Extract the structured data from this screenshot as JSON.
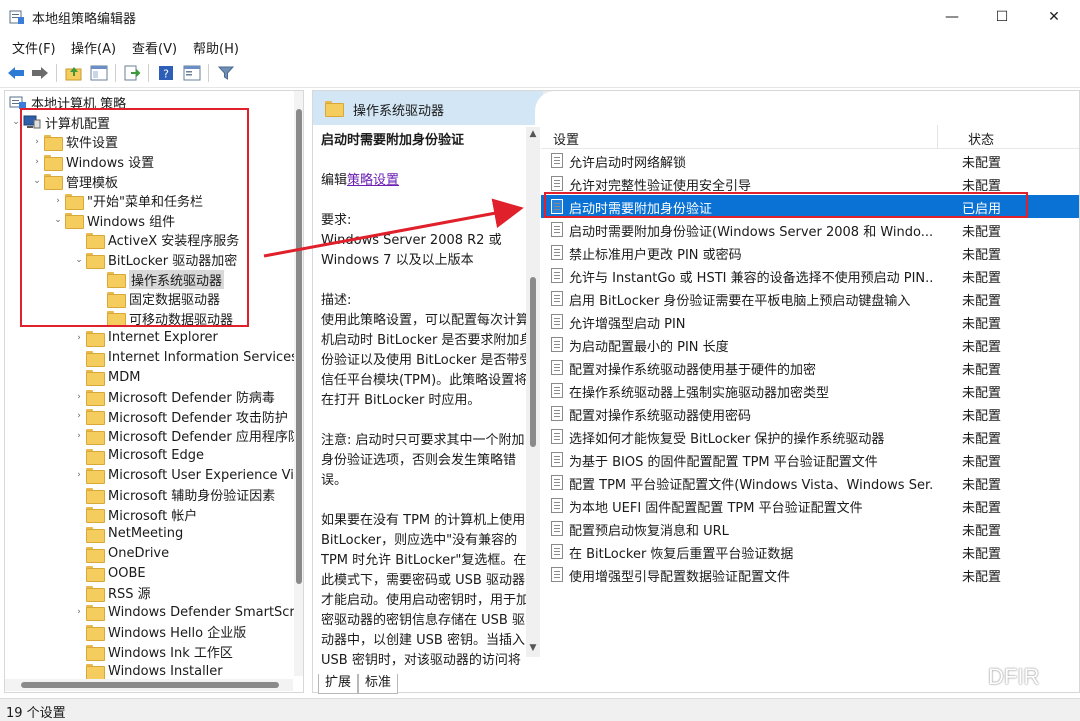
{
  "window": {
    "title": "本地组策略编辑器",
    "minimize": "—",
    "maximize": "☐",
    "close": "✕"
  },
  "menu": [
    "文件(F)",
    "操作(A)",
    "查看(V)",
    "帮助(H)"
  ],
  "toolbar": {
    "icons": [
      "back-arrow-icon",
      "forward-arrow-icon",
      "up-folder-icon",
      "show-hide-tree-icon",
      "export-list-icon",
      "help-icon",
      "properties-icon",
      "filter-icon"
    ]
  },
  "tree": {
    "items": [
      {
        "label": "本地计算机 策略",
        "icon": "computer-policy-icon",
        "arrow": ""
      },
      {
        "label": "计算机配置",
        "icon": "computer-icon",
        "arrow": "⌄"
      },
      {
        "label": "软件设置",
        "icon": "folder-icon",
        "arrow": "›"
      },
      {
        "label": "Windows 设置",
        "icon": "folder-icon",
        "arrow": "›"
      },
      {
        "label": "管理模板",
        "icon": "folder-icon",
        "arrow": "⌄"
      },
      {
        "label": "\"开始\"菜单和任务栏",
        "icon": "folder-icon",
        "arrow": "›"
      },
      {
        "label": "Windows 组件",
        "icon": "folder-icon",
        "arrow": "⌄"
      },
      {
        "label": "ActiveX 安装程序服务",
        "icon": "folder-icon",
        "arrow": ""
      },
      {
        "label": "BitLocker 驱动器加密",
        "icon": "folder-icon",
        "arrow": "⌄"
      },
      {
        "label": "操作系统驱动器",
        "icon": "folder-icon",
        "arrow": "",
        "selected": true
      },
      {
        "label": "固定数据驱动器",
        "icon": "folder-icon",
        "arrow": ""
      },
      {
        "label": "可移动数据驱动器",
        "icon": "folder-icon",
        "arrow": ""
      },
      {
        "label": "Internet Explorer",
        "icon": "folder-icon",
        "arrow": "›"
      },
      {
        "label": "Internet Information Services",
        "icon": "folder-icon",
        "arrow": ""
      },
      {
        "label": "MDM",
        "icon": "folder-icon",
        "arrow": ""
      },
      {
        "label": "Microsoft Defender 防病毒",
        "icon": "folder-icon",
        "arrow": "›"
      },
      {
        "label": "Microsoft Defender 攻击防护",
        "icon": "folder-icon",
        "arrow": "›"
      },
      {
        "label": "Microsoft Defender 应用程序防",
        "icon": "folder-icon",
        "arrow": "›"
      },
      {
        "label": "Microsoft Edge",
        "icon": "folder-icon",
        "arrow": ""
      },
      {
        "label": "Microsoft User Experience Vir",
        "icon": "folder-icon",
        "arrow": "›"
      },
      {
        "label": "Microsoft 辅助身份验证因素",
        "icon": "folder-icon",
        "arrow": ""
      },
      {
        "label": "Microsoft 帐户",
        "icon": "folder-icon",
        "arrow": ""
      },
      {
        "label": "NetMeeting",
        "icon": "folder-icon",
        "arrow": ""
      },
      {
        "label": "OneDrive",
        "icon": "folder-icon",
        "arrow": ""
      },
      {
        "label": "OOBE",
        "icon": "folder-icon",
        "arrow": ""
      },
      {
        "label": "RSS 源",
        "icon": "folder-icon",
        "arrow": ""
      },
      {
        "label": "Windows Defender SmartScre",
        "icon": "folder-icon",
        "arrow": "›"
      },
      {
        "label": "Windows Hello 企业版",
        "icon": "folder-icon",
        "arrow": ""
      },
      {
        "label": "Windows Ink 工作区",
        "icon": "folder-icon",
        "arrow": ""
      },
      {
        "label": "Windows Installer",
        "icon": "folder-icon",
        "arrow": ""
      }
    ]
  },
  "right_header": {
    "label": "操作系统驱动器"
  },
  "description": {
    "title": "启动时需要附加身份验证",
    "edit_prefix": "编辑",
    "edit_link": "策略设置",
    "requirements_label": "要求:",
    "requirements_text": "Windows Server 2008 R2 或 Windows 7 以及以上版本",
    "description_label": "描述:",
    "description_text": "使用此策略设置，可以配置每次计算机启动时 BitLocker 是否要求附加身份验证以及使用 BitLocker 是否带受信任平台模块(TPM)。此策略设置将在打开 BitLocker 时应用。",
    "note_text": "注意: 启动时只可要求其中一个附加身份验证选项，否则会发生策略错误。",
    "more_text": "如果要在没有 TPM 的计算机上使用 BitLocker，则应选中\"没有兼容的 TPM 时允许 BitLocker\"复选框。在此模式下，需要密码或 USB 驱动器才能启动。使用启动密钥时，用于加密驱动器的密钥信息存储在 USB 驱动器中，以创建 USB 密钥。当插入 USB 密钥时，对该驱动器的访问将通过身份验"
  },
  "list": {
    "col_setting": "设置",
    "col_state": "状态",
    "rows": [
      {
        "name": "允许启动时网络解锁",
        "state": "未配置"
      },
      {
        "name": "允许对完整性验证使用安全引导",
        "state": "未配置"
      },
      {
        "name": "启动时需要附加身份验证",
        "state": "已启用",
        "selected": true
      },
      {
        "name": "启动时需要附加身份验证(Windows Server 2008 和 Windo...",
        "state": "未配置"
      },
      {
        "name": "禁止标准用户更改 PIN 或密码",
        "state": "未配置"
      },
      {
        "name": "允许与 InstantGo 或 HSTI 兼容的设备选择不使用预启动 PIN...",
        "state": "未配置"
      },
      {
        "name": "启用 BitLocker 身份验证需要在平板电脑上预启动键盘输入",
        "state": "未配置"
      },
      {
        "name": "允许增强型启动 PIN",
        "state": "未配置"
      },
      {
        "name": "为启动配置最小的 PIN 长度",
        "state": "未配置"
      },
      {
        "name": "配置对操作系统驱动器使用基于硬件的加密",
        "state": "未配置"
      },
      {
        "name": "在操作系统驱动器上强制实施驱动器加密类型",
        "state": "未配置"
      },
      {
        "name": "配置对操作系统驱动器使用密码",
        "state": "未配置"
      },
      {
        "name": "选择如何才能恢复受 BitLocker 保护的操作系统驱动器",
        "state": "未配置"
      },
      {
        "name": "为基于 BIOS 的固件配置配置 TPM 平台验证配置文件",
        "state": "未配置"
      },
      {
        "name": "配置 TPM 平台验证配置文件(Windows Vista、Windows Ser...",
        "state": "未配置"
      },
      {
        "name": "为本地 UEFI 固件配置配置 TPM 平台验证配置文件",
        "state": "未配置"
      },
      {
        "name": "配置预启动恢复消息和 URL",
        "state": "未配置"
      },
      {
        "name": "在 BitLocker 恢复后重置平台验证数据",
        "state": "未配置"
      },
      {
        "name": "使用增强型引导配置数据验证配置文件",
        "state": "未配置"
      }
    ]
  },
  "bottom_tabs": [
    "扩展",
    "标准"
  ],
  "status": "19 个设置",
  "watermark": "DFIR",
  "colors": {
    "selection": "#0a72d4",
    "annotation_red": "#e0202a",
    "header_tab": "#d2e6f5",
    "link": "#6b1fb3"
  }
}
